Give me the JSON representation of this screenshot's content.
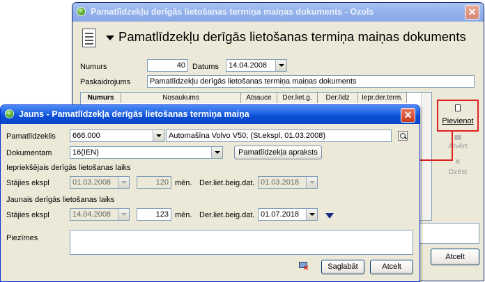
{
  "main_window": {
    "title": "Pamatlīdzekļu derīgās lietošanas termiņa maiņas dokuments - Ozols",
    "close": "✕",
    "header_title": "Pamatlīdzekļu derīgās lietošanas termiņa maiņas dokuments",
    "fields": {
      "numurs_label": "Numurs",
      "numurs_value": "40",
      "datums_label": "Datums",
      "datums_value": "14.04.2008",
      "paskaidrojums_label": "Paskaidrojums",
      "paskaidrojums_value": "Pamatlīdzekļu derīgās lietošanas termiņa maiņas dokuments"
    },
    "table_headers": [
      "Numurs",
      "Nosaukums",
      "Atsauce",
      "Der.liet.g.",
      "Der.līdz",
      "Iepr.der.term."
    ],
    "side_buttons": {
      "add": "Pievienot",
      "open": "Atvērt",
      "delete": "Dzēst"
    },
    "cancel": "Atcelt"
  },
  "dialog": {
    "title": "Jauns - Pamatlīdzekļa derīgās lietošanas termiņa maiņa",
    "close": "✕",
    "pamatlidzeklis_label": "Pamatlīdzeklis",
    "pamatlidzeklis_value": "666.000",
    "pamatlidzeklis_desc": "Automašīna Volvo V50; (St.ekspl. 01.03.2008)",
    "dokumentam_label": "Dokumentam",
    "dokumentam_value": "16(IEN)",
    "apraksts_button": "Pamatlīdzekļa apraksts",
    "previous_section": "Iepriekšējais derīgās lietošanas laiks",
    "new_section": "Jaunais derīgās lietošanas laiks",
    "stajies_label": "Stājies ekspl",
    "prev_start": "01.03.2008",
    "prev_months": "120",
    "men_label": "mēn.",
    "der_beig_label": "Der.liet.beig.dat.",
    "prev_end": "01.03.2018",
    "new_start": "14.04.2008",
    "new_months": "123",
    "new_end": "01.07.2018",
    "piezimes_label": "Piezīmes",
    "piezimes_value": "",
    "save_button": "Saglabāt",
    "cancel_button": "Atcelt"
  },
  "colors": {
    "annotation_red": "#dd2020",
    "titlebar_blue": "#0b4fd6",
    "window_bg": "#ece9d8"
  }
}
